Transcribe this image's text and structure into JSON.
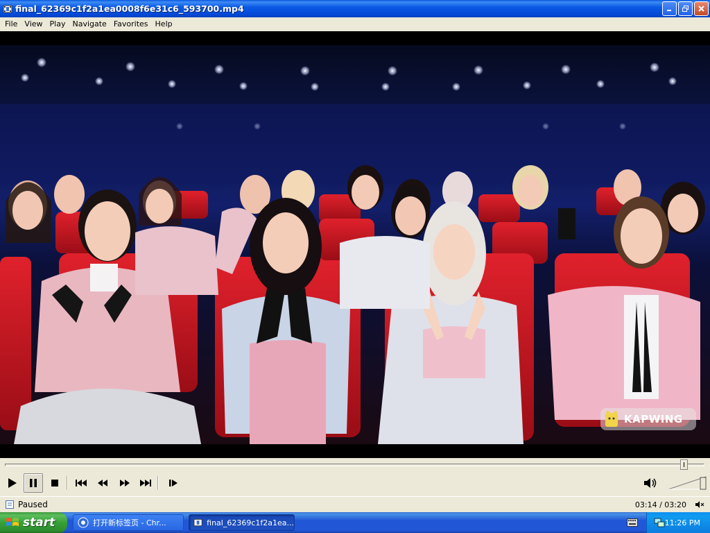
{
  "window": {
    "title": "final_62369c1f2a1ea0008f6e31c6_593700.mp4"
  },
  "menu": [
    "File",
    "View",
    "Play",
    "Navigate",
    "Favorites",
    "Help"
  ],
  "video": {
    "watermark": "KAPWING"
  },
  "controls": {
    "progress_fraction": 0.971,
    "volume_fraction": 1.0,
    "buttons": [
      "play-icon",
      "pause-icon",
      "stop-icon",
      "skip-back-icon",
      "rewind-icon",
      "fast-forward-icon",
      "skip-forward-icon",
      "frame-step-icon",
      "speaker-icon"
    ]
  },
  "status": {
    "state": "Paused",
    "time": "03:14 / 03:20"
  },
  "taskbar": {
    "start_label": "start",
    "tasks": [
      {
        "label": "打开新标签页 - Chr..."
      },
      {
        "label": "final_62369c1f2a1ea..."
      }
    ],
    "clock": "11:26 PM"
  }
}
